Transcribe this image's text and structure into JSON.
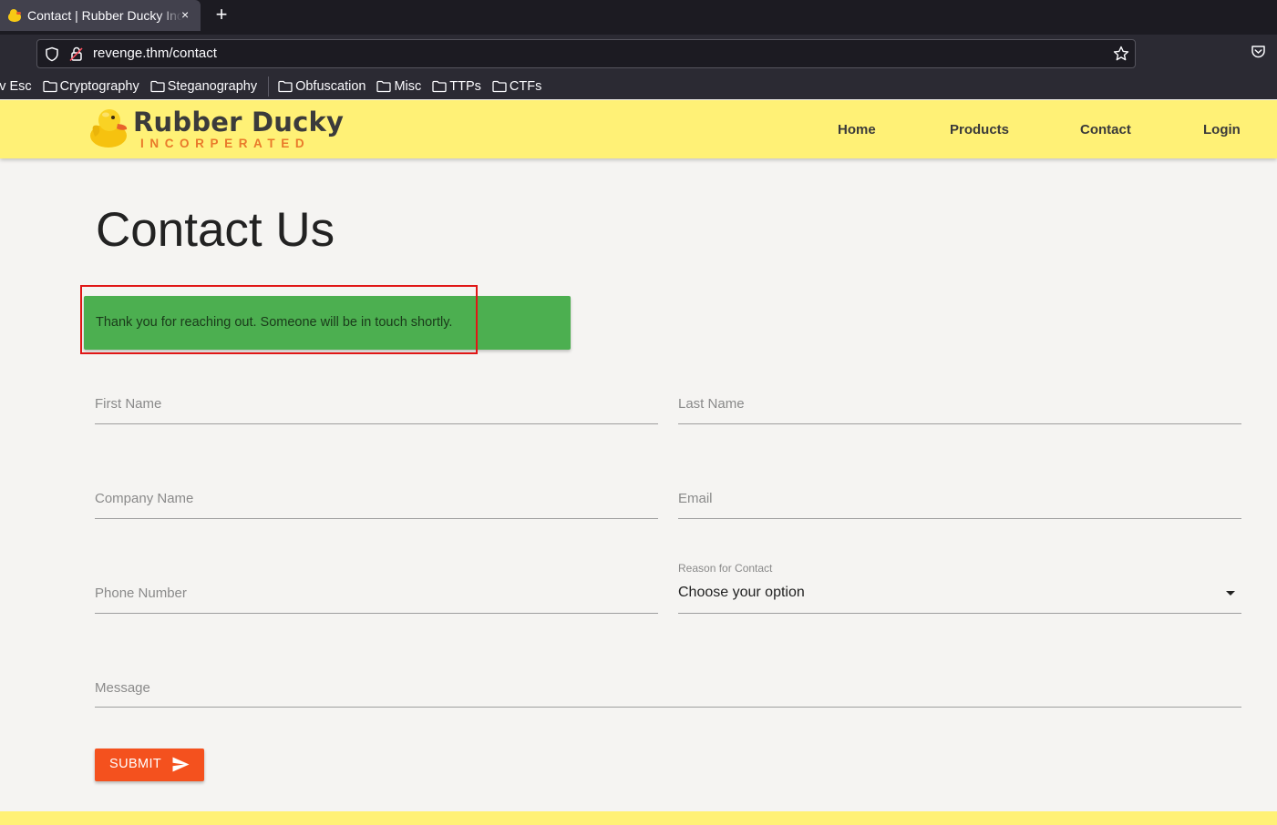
{
  "browser": {
    "tab_title": "Contact | Rubber Ducky Inc.",
    "close_glyph": "×",
    "newtab_glyph": "+",
    "url": "revenge.thm/contact",
    "bookmarks": [
      "iv Esc",
      "Cryptography",
      "Steganography",
      "Obfuscation",
      "Misc",
      "TTPs",
      "CTFs"
    ]
  },
  "site": {
    "brand_name": "Rubber Ducky",
    "brand_sub": "INCORPERATED",
    "nav": [
      "Home",
      "Products",
      "Contact",
      "Login"
    ]
  },
  "page": {
    "title": "Contact Us",
    "alert": "Thank you for reaching out. Someone will be in touch shortly."
  },
  "form": {
    "first_name": "First Name",
    "last_name": "Last Name",
    "company_name": "Company Name",
    "email": "Email",
    "phone": "Phone Number",
    "reason_label": "Reason for Contact",
    "reason_value": "Choose your option",
    "message": "Message",
    "submit": "SUBMIT"
  },
  "colors": {
    "header": "#fff176",
    "alert": "#4caf50",
    "submit": "#f4511e",
    "highlight": "#e01616"
  }
}
